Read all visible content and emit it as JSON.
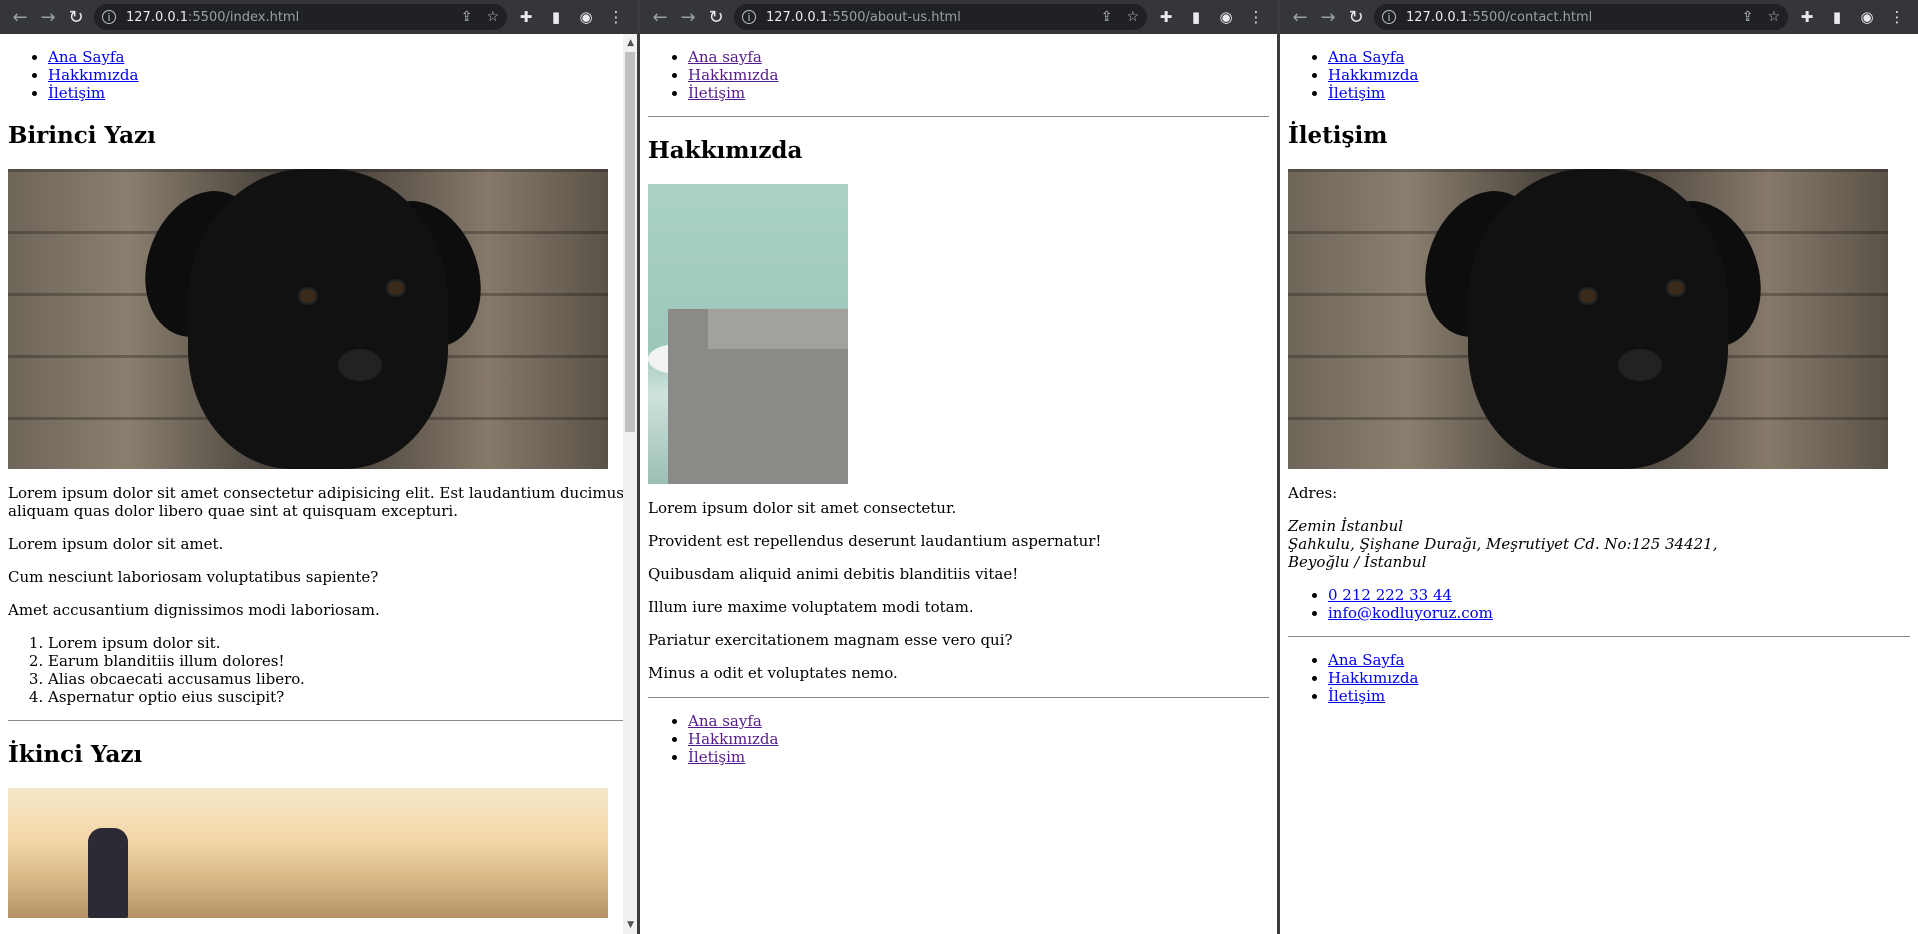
{
  "windows": [
    {
      "url_host": "127.0.0.1",
      "url_path": ":5500/index.html",
      "nav": [
        "Ana Sayfa",
        "Hakkımızda",
        "İletişim"
      ],
      "articles": [
        {
          "title": "Birinci Yazı",
          "paragraphs": [
            "Lorem ipsum dolor sit amet consectetur adipisicing elit. Est laudantium ducimus aliquam quas dolor libero quae sint at quisquam excepturi.",
            "Lorem ipsum dolor sit amet.",
            "Cum nesciunt laboriosam voluptatibus sapiente?",
            "Amet accusantium dignissimos modi laboriosam."
          ],
          "list": [
            "Lorem ipsum dolor sit.",
            "Earum blanditiis illum dolores!",
            "Alias obcaecati accusamus libero.",
            "Aspernatur optio eius suscipit?"
          ]
        },
        {
          "title": "İkinci Yazı"
        }
      ]
    },
    {
      "url_host": "127.0.0.1",
      "url_path": ":5500/about-us.html",
      "nav": [
        "Ana sayfa",
        "Hakkımızda",
        "İletişim"
      ],
      "title": "Hakkımızda",
      "paragraphs": [
        "Lorem ipsum dolor sit amet consectetur.",
        "Provident est repellendus deserunt laudantium aspernatur!",
        "Quibusdam aliquid animi debitis blanditiis vitae!",
        "Illum iure maxime voluptatem modi totam.",
        "Pariatur exercitationem magnam esse vero qui?",
        "Minus a odit et voluptates nemo."
      ],
      "footer_nav": [
        "Ana sayfa",
        "Hakkımızda",
        "İletişim"
      ]
    },
    {
      "url_host": "127.0.0.1",
      "url_path": ":5500/contact.html",
      "nav": [
        "Ana Sayfa",
        "Hakkımızda",
        "İletişim"
      ],
      "title": "İletişim",
      "address_label": "Adres:",
      "address_lines": [
        "Zemin İstanbul",
        "Şahkulu, Şişhane Durağı, Meşrutiyet Cd. No:125 34421,",
        "Beyoğlu / İstanbul"
      ],
      "contacts": [
        "0 212 222 33 44",
        "info@kodluyoruz.com"
      ],
      "footer_nav": [
        "Ana Sayfa",
        "Hakkımızda",
        "İletişim"
      ]
    }
  ],
  "colors": {
    "link": "#0000ee",
    "visited": "#551a8b",
    "toolbar": "#35363a",
    "omnibox": "#202124"
  }
}
